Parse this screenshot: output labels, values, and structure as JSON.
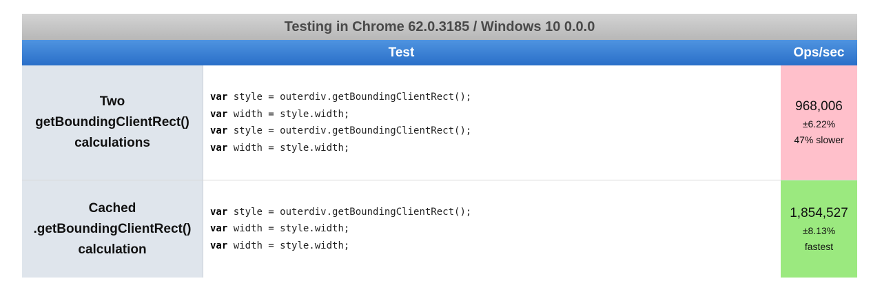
{
  "caption": "Testing in Chrome 62.0.3185 / Windows 10 0.0.0",
  "columns": {
    "test": "Test",
    "ops": "Ops/sec"
  },
  "tests": [
    {
      "title": "Two\ngetBoundingClientRect()\ncalculations",
      "code": [
        {
          "kw": "var",
          "rest": " style = outerdiv.getBoundingClientRect();"
        },
        {
          "kw": "var",
          "rest": " width = style.width;"
        },
        {
          "kw": "var",
          "rest": " style = outerdiv.getBoundingClientRect();"
        },
        {
          "kw": "var",
          "rest": " width = style.width;"
        }
      ],
      "ops": "968,006",
      "error": "±6.22%",
      "relative": "47% slower",
      "status_color": "#ffc0cb"
    },
    {
      "title": "Cached\n.getBoundingClientRect()\ncalculation",
      "code": [
        {
          "kw": "var",
          "rest": " style = outerdiv.getBoundingClientRect();"
        },
        {
          "kw": "var",
          "rest": " width = style.width;"
        },
        {
          "kw": "var",
          "rest": " width = style.width;"
        }
      ],
      "ops": "1,854,527",
      "error": "±8.13%",
      "relative": "fastest",
      "status_color": "#9be97f"
    }
  ]
}
